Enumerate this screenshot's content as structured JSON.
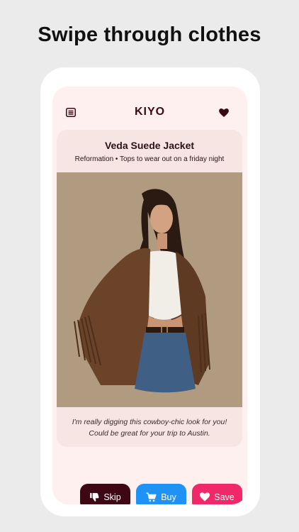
{
  "headline": "Swipe through clothes",
  "app": {
    "logo": "KIYO"
  },
  "icons": {
    "menu": "menu-icon",
    "favorites": "heart-icon"
  },
  "product": {
    "name": "Veda Suede Jacket",
    "subtitle": "Reformation • Tops to wear out on a friday night",
    "caption": "I'm really digging this cowboy-chic look for you! Could be great for your trip to Austin."
  },
  "actions": {
    "skip": {
      "label": "Skip",
      "icon": "thumbs-down-icon",
      "color": "#3d0713"
    },
    "buy": {
      "label": "Buy",
      "icon": "cart-icon",
      "color": "#1e93f5"
    },
    "save": {
      "label": "Save",
      "icon": "heart-icon",
      "color": "#f0286a"
    }
  },
  "colors": {
    "background": "#ebebeb",
    "screen": "#fdf0ee",
    "card": "#f7e5e4",
    "brand": "#3c0a12"
  }
}
